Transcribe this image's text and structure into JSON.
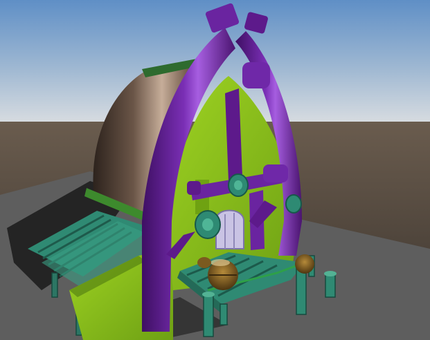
{
  "scene": {
    "description_name": "3d-viewport",
    "colors": {
      "sky_top": "#6f9ac9",
      "sky_horizon": "#d8dde2",
      "ground_far": "#5a4f44",
      "ground_near": "#3c3631",
      "platform": "#5f5f5f",
      "platform_dark": "#3e3e3e",
      "purple": "#5a1a86",
      "purple_light": "#8a3bc2",
      "lime": "#8cc21c",
      "lime_dark": "#5e8f12",
      "teal": "#2a7a66",
      "teal_light": "#53b294",
      "roof_dark": "#3a2e26",
      "roof_light": "#a98f7c",
      "trim_green": "#2e6b2e",
      "door": "#bdb7d9",
      "barrel": "#7b5a1f"
    }
  }
}
